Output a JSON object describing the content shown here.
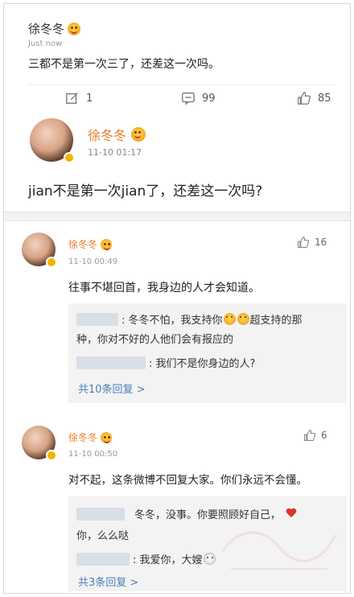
{
  "post": {
    "author": "徐冬冬",
    "time": "Just now",
    "text": "三都不是第一次三了，还差这一次吗。",
    "actions": {
      "repost": "1",
      "comment": "99",
      "like": "85"
    }
  },
  "featured": {
    "author": "徐冬冬",
    "time": "11-10 01:17",
    "text": "jian不是第一次jian了，还差这一次吗?"
  },
  "comments": [
    {
      "author": "徐冬冬",
      "time": "11-10 00:49",
      "likes": "16",
      "text": "往事不堪回首，我身边的人才会知道。",
      "replies": [
        {
          "line1_before": ": 冬冬不怕，我支持你",
          "line1_after": "超支持的那",
          "line2": "种，你对不好的人他们会有报应的"
        },
        {
          "line1": ": 我们不是你身边的人?"
        }
      ],
      "more": "共10条回复 >"
    },
    {
      "author": "徐冬冬",
      "time": "11-10 00:50",
      "likes": "6",
      "text": "对不起，这条微博不回复大家。你们永远不会懂。",
      "replies": [
        {
          "line1": "冬冬，没事。你要照顾好自己，",
          "line2": "你，么么哒"
        },
        {
          "line1": ": 我爱你，大嫂"
        }
      ],
      "more": "共3条回复 >"
    }
  ],
  "colors": {
    "accent": "#e97c2a",
    "link": "#4a7fb8"
  },
  "icons": {
    "repost": "edit-icon",
    "comment": "comment-icon",
    "like": "thumbs-up-icon"
  }
}
